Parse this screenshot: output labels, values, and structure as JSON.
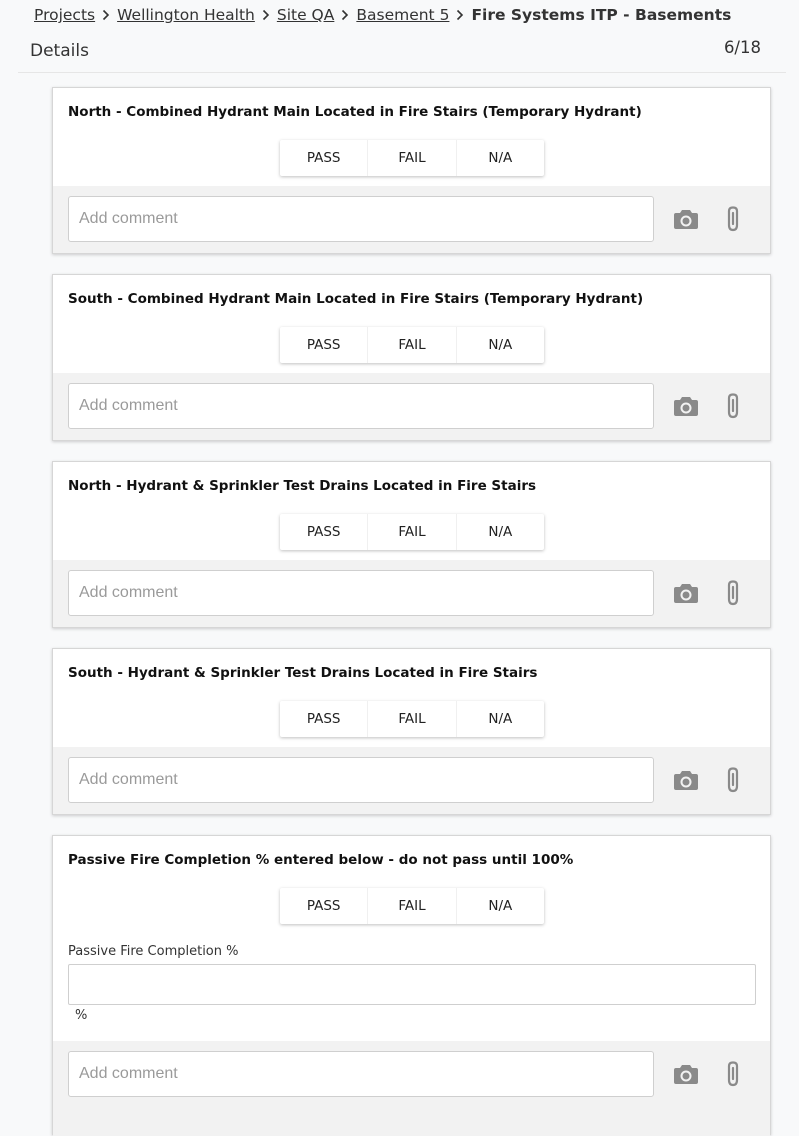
{
  "breadcrumb": {
    "items": [
      "Projects",
      "Wellington Health",
      "Site QA",
      "Basement 5"
    ],
    "current": "Fire Systems ITP - Basements"
  },
  "header": {
    "title": "Details",
    "progress": "6/18"
  },
  "options": [
    "PASS",
    "FAIL",
    "N/A"
  ],
  "comment_placeholder": "Add comment",
  "items": [
    {
      "title": "North - Combined Hydrant Main Located in Fire Stairs (Temporary Hydrant)"
    },
    {
      "title": "South - Combined Hydrant Main Located in Fire Stairs (Temporary Hydrant)"
    },
    {
      "title": "North - Hydrant & Sprinkler Test Drains Located in Fire Stairs"
    },
    {
      "title": "South - Hydrant & Sprinkler Test Drains Located in Fire Stairs"
    },
    {
      "title": "Passive Fire Completion % entered below - do not pass until 100%",
      "field_label": "Passive Fire Completion %",
      "field_value": "",
      "field_unit": "%"
    }
  ],
  "colors": {
    "background": "#f8f9fa",
    "card": "#ffffff",
    "comment_strip": "#f2f2f2",
    "icon": "#8a8a8a"
  },
  "icons": [
    "chevron-right-icon",
    "camera-icon",
    "paperclip-icon"
  ]
}
